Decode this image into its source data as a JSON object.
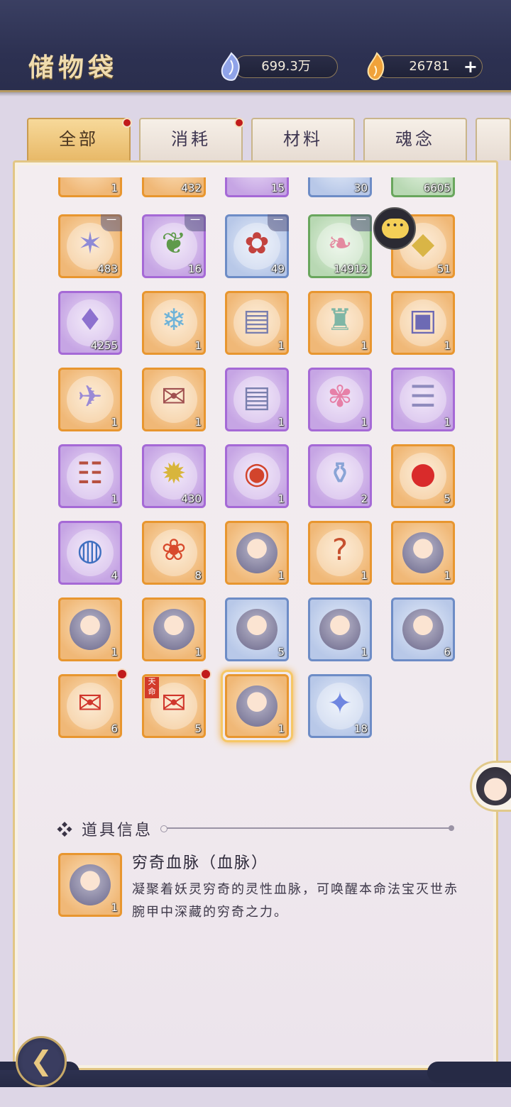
{
  "header": {
    "title": "储物袋",
    "currency1": {
      "value": "699.3万",
      "icon": "spirit-stone-icon"
    },
    "currency2": {
      "value": "26781",
      "icon": "flame-jade-icon",
      "add_label": "+"
    }
  },
  "tabs": [
    {
      "label": "全部",
      "active": true,
      "badge": true
    },
    {
      "label": "消耗",
      "active": false,
      "badge": true
    },
    {
      "label": "材料",
      "active": false,
      "badge": false
    },
    {
      "label": "魂念",
      "active": false,
      "badge": false
    }
  ],
  "grid": {
    "partial_row": [
      {
        "rarity": "orange",
        "count": "1"
      },
      {
        "rarity": "orange",
        "count": "432"
      },
      {
        "rarity": "purple",
        "count": "15"
      },
      {
        "rarity": "blue",
        "count": "30"
      },
      {
        "rarity": "green",
        "count": "6605"
      }
    ],
    "rows": [
      [
        {
          "rarity": "orange",
          "icon": "crystal-cluster-icon",
          "count": "483",
          "corner": "一"
        },
        {
          "rarity": "purple",
          "icon": "berry-sprig-icon",
          "count": "16",
          "corner": "一"
        },
        {
          "rarity": "blue",
          "icon": "red-herb-icon",
          "count": "49",
          "corner": "一"
        },
        {
          "rarity": "green",
          "icon": "coral-icon",
          "count": "14912",
          "corner": "一"
        },
        {
          "rarity": "orange",
          "icon": "gold-crystal-icon",
          "count": "51",
          "corner": ""
        }
      ],
      [
        {
          "rarity": "purple",
          "icon": "violet-crystal-icon",
          "count": "4255",
          "corner": ""
        },
        {
          "rarity": "orange",
          "icon": "ice-shards-icon",
          "count": "1",
          "corner": ""
        },
        {
          "rarity": "orange",
          "icon": "talisman-paper-icon",
          "count": "1",
          "corner": ""
        },
        {
          "rarity": "orange",
          "icon": "jade-pendant-icon",
          "count": "1",
          "corner": ""
        },
        {
          "rarity": "orange",
          "icon": "treasure-chest-icon",
          "count": "1",
          "corner": ""
        }
      ],
      [
        {
          "rarity": "orange",
          "icon": "paper-crane-icon",
          "count": "1",
          "corner": ""
        },
        {
          "rarity": "orange",
          "icon": "letter-icon",
          "count": "1",
          "corner": ""
        },
        {
          "rarity": "purple",
          "icon": "talisman-paper-icon",
          "count": "1",
          "corner": ""
        },
        {
          "rarity": "purple",
          "icon": "pink-tassel-icon",
          "count": "1",
          "corner": ""
        },
        {
          "rarity": "purple",
          "icon": "scroll-icon",
          "count": "1",
          "corner": ""
        }
      ],
      [
        {
          "rarity": "purple",
          "icon": "red-scroll-icon",
          "count": "1",
          "corner": ""
        },
        {
          "rarity": "purple",
          "icon": "golden-sun-icon",
          "count": "430",
          "corner": ""
        },
        {
          "rarity": "purple",
          "icon": "divine-orb-icon",
          "count": "1",
          "corner": ""
        },
        {
          "rarity": "purple",
          "icon": "porcelain-vase-icon",
          "count": "2",
          "corner": ""
        },
        {
          "rarity": "orange",
          "icon": "fire-orb-icon",
          "count": "5",
          "corner": ""
        }
      ],
      [
        {
          "rarity": "purple",
          "icon": "water-orb-icon",
          "count": "4",
          "corner": ""
        },
        {
          "rarity": "orange",
          "icon": "lotus-flame-icon",
          "count": "8",
          "corner": ""
        },
        {
          "rarity": "orange",
          "icon": "character-portrait-icon",
          "count": "1",
          "corner": ""
        },
        {
          "rarity": "orange",
          "icon": "mystery-pouch-icon",
          "count": "1",
          "corner": ""
        },
        {
          "rarity": "orange",
          "icon": "character-portrait-icon",
          "count": "1",
          "corner": ""
        }
      ],
      [
        {
          "rarity": "orange",
          "icon": "character-portrait-icon",
          "count": "1",
          "corner": ""
        },
        {
          "rarity": "orange",
          "icon": "character-portrait-icon",
          "count": "1",
          "corner": ""
        },
        {
          "rarity": "blue",
          "icon": "character-portrait-icon",
          "count": "5",
          "corner": ""
        },
        {
          "rarity": "blue",
          "icon": "character-portrait-icon",
          "count": "1",
          "corner": ""
        },
        {
          "rarity": "blue",
          "icon": "character-portrait-icon",
          "count": "6",
          "corner": ""
        }
      ],
      [
        {
          "rarity": "orange",
          "icon": "red-envelope-icon",
          "count": "6",
          "corner": "",
          "badge": true
        },
        {
          "rarity": "orange",
          "icon": "fate-envelope-icon",
          "count": "5",
          "corner": "",
          "badge": true,
          "tag": "天命"
        },
        {
          "rarity": "orange",
          "icon": "character-portrait-icon",
          "count": "1",
          "corner": "",
          "selected": true
        },
        {
          "rarity": "blue",
          "icon": "blue-gauntlet-icon",
          "count": "18",
          "corner": ""
        }
      ]
    ]
  },
  "info": {
    "section_title": "❖ 道具信息",
    "item_name": "穷奇血脉（血脉）",
    "item_desc": "凝聚着妖灵穷奇的灵性血脉，可唤醒本命法宝灭世赤腕甲中深藏的穷奇之力。",
    "item_count": "1"
  },
  "buttons": {
    "back_icon": "back-arrow-icon",
    "chat_icon": "chat-bubble-icon"
  }
}
